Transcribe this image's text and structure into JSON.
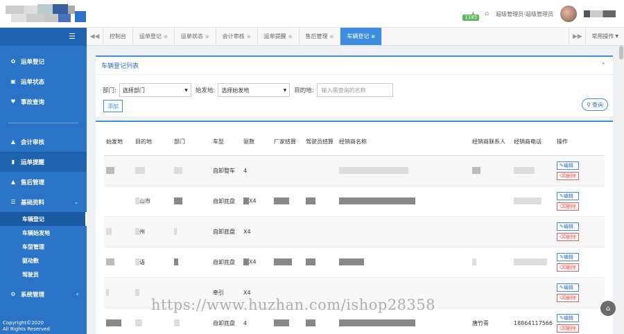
{
  "header": {
    "notification_count": "1185",
    "role_text": "超级管理员-超级管理员",
    "home_icon": "home-icon",
    "bell_icon": "bell-icon"
  },
  "sidebar": {
    "toggle_icon": "menu-icon",
    "items": [
      {
        "label": "运单登记",
        "icon": "paw-icon"
      },
      {
        "label": "运单状态",
        "icon": "sitemap-icon"
      },
      {
        "label": "事故查询",
        "icon": "heart-icon"
      },
      {
        "label": "会计审核",
        "icon": "bank-icon"
      },
      {
        "label": "运单提醒",
        "icon": "chart-icon"
      },
      {
        "label": "售后管理",
        "icon": "thumbs-up-icon"
      },
      {
        "label": "基础资料",
        "icon": "list-icon"
      },
      {
        "label": "系统管理",
        "icon": "gear-icon"
      }
    ],
    "sub_items": [
      "车辆登记",
      "车辆始发地",
      "车型管理",
      "驱动数",
      "驾驶员"
    ],
    "copyright": "Copyright©2020",
    "rights": "All Rights Reserved"
  },
  "tabs": {
    "items": [
      "控制台",
      "运单登记",
      "运单状态",
      "会计审核",
      "运单提醒",
      "售后管理",
      "车辆登记"
    ],
    "active": "车辆登记",
    "ops_label": "常用操作"
  },
  "panel": {
    "title": "车辆登记列表",
    "dept_label": "部门:",
    "dept_value": "选择部门",
    "origin_label": "始发地:",
    "origin_value": "选择始发地",
    "dest_label": "目的地:",
    "dest_placeholder": "输入需查询的名称",
    "add_label": "添加",
    "search_label": "查询"
  },
  "table": {
    "headers": [
      "始发地",
      "目的地",
      "部门",
      "车型",
      "驱数",
      "厂家结算",
      "驾驶员结算",
      "经销商名称",
      "经销商联系人",
      "经销商电话",
      "操作"
    ],
    "rows": [
      {
        "type": "自卸整车",
        "drive": "4",
        "dest": "",
        "contact": "",
        "phone": ""
      },
      {
        "type": "自卸底盘",
        "drive": "X4",
        "dest": "山市",
        "contact": "",
        "phone": ""
      },
      {
        "type": "自卸底盘",
        "drive": "X4",
        "dest": "州",
        "contact": "",
        "phone": ""
      },
      {
        "type": "自卸底盘",
        "drive": "X4",
        "dest": "语",
        "contact": "",
        "phone": ""
      },
      {
        "type": "牵引",
        "drive": "X4",
        "dest": "",
        "contact": "",
        "phone": ""
      },
      {
        "type": "自卸底盘",
        "drive": "4",
        "dest": "",
        "contact": "唐竹青",
        "phone": "18864117566"
      }
    ],
    "edit_label": "编辑",
    "delete_label": "删除"
  },
  "watermark": "https://www.huzhan.com/ishop28358",
  "colors": {
    "accent": "#3d8ee0",
    "sidebar": "#2a73c7",
    "danger": "#d9534f"
  }
}
